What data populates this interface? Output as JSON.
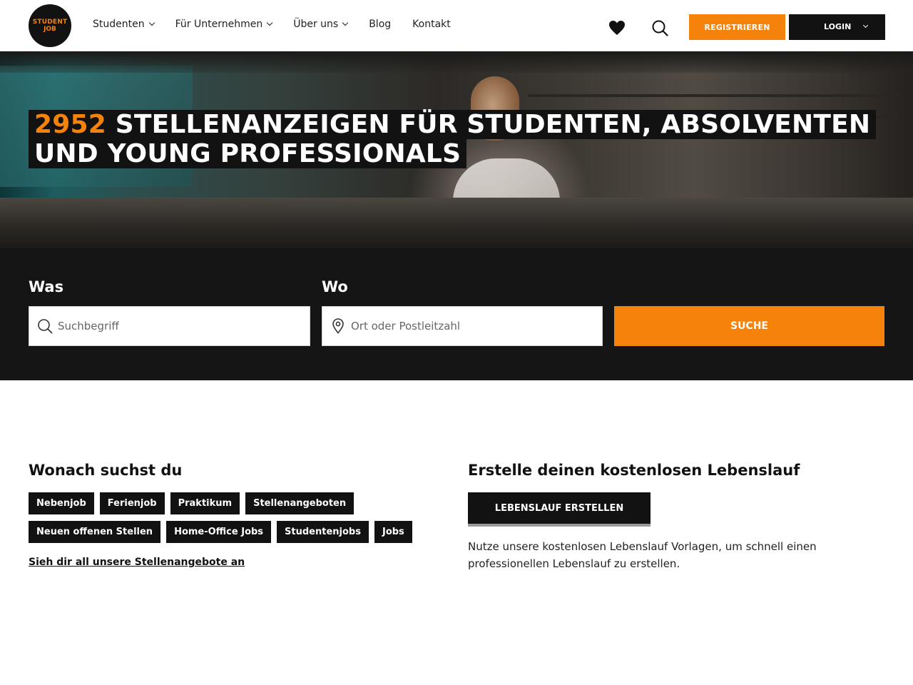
{
  "header": {
    "logo": {
      "line1": "STUDENT",
      "line2": "JOB"
    },
    "nav": [
      {
        "label": "Studenten",
        "dropdown": true
      },
      {
        "label": "Für Unternehmen",
        "dropdown": true
      },
      {
        "label": "Über uns",
        "dropdown": true
      },
      {
        "label": "Blog",
        "dropdown": false
      },
      {
        "label": "Kontakt",
        "dropdown": false
      }
    ],
    "icons": {
      "favorites": "heart-icon",
      "search": "search-icon"
    },
    "register_label": "REGISTRIEREN",
    "login_label": "LOGIN"
  },
  "hero": {
    "count": "2952",
    "headline_line1": "STELLENANZEIGEN FÜR STUDENTEN, ABSOLVENTEN",
    "headline_line2": "UND YOUNG PROFESSIONALS"
  },
  "search": {
    "what_label": "Was",
    "what_placeholder": "Suchbegriff",
    "what_value": "",
    "where_label": "Wo",
    "where_placeholder": "Ort oder Postleitzahl",
    "where_value": "",
    "submit_label": "SUCHE"
  },
  "categories": {
    "title": "Wonach suchst du",
    "row1": [
      "Nebenjob",
      "Ferienjob",
      "Praktikum",
      "Stellenangeboten"
    ],
    "row2": [
      "Neuen offenen Stellen",
      "Home-Office Jobs",
      "Studentenjobs",
      "Jobs"
    ],
    "all_link": "Sieh dir all unsere Stellenangebote an"
  },
  "cv": {
    "title": "Erstelle deinen kostenlosen Lebenslauf",
    "button_label": "LEBENSLAUF ERSTELLEN",
    "text": "Nutze unsere kostenlosen Lebenslauf Vorlagen, um schnell einen professionellen Lebenslauf zu erstellen."
  },
  "colors": {
    "accent": "#f5820b",
    "dark": "#121212",
    "band": "#151515"
  }
}
